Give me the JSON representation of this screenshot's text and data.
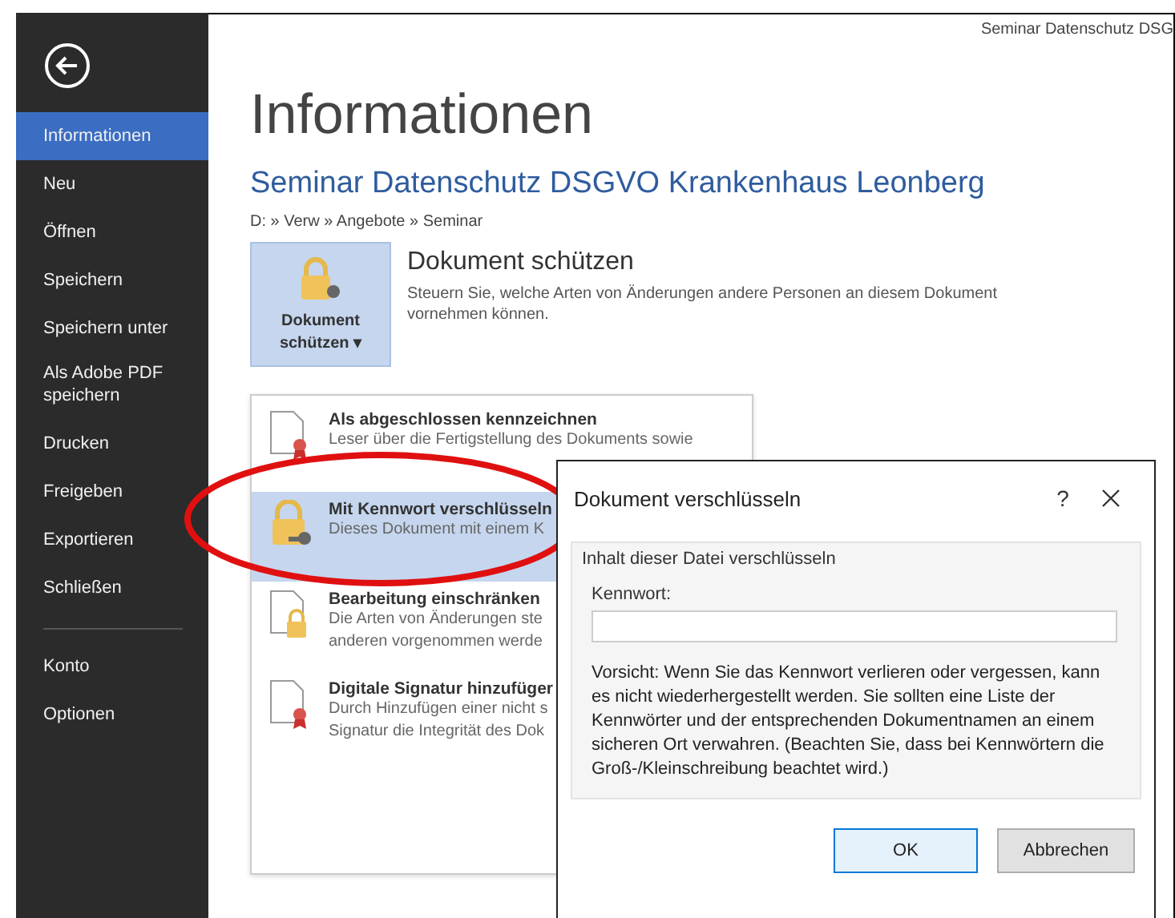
{
  "window": {
    "title": "Seminar Datenschutz DSG"
  },
  "sidebar": {
    "items": [
      {
        "label": "Informationen",
        "selected": true
      },
      {
        "label": "Neu",
        "selected": false
      },
      {
        "label": "Öffnen",
        "selected": false
      },
      {
        "label": "Speichern",
        "selected": false
      },
      {
        "label": "Speichern unter",
        "selected": false
      },
      {
        "label": "Als Adobe PDF speichern",
        "selected": false
      },
      {
        "label": "Drucken",
        "selected": false
      },
      {
        "label": "Freigeben",
        "selected": false
      },
      {
        "label": "Exportieren",
        "selected": false
      },
      {
        "label": "Schließen",
        "selected": false
      }
    ],
    "bottom_items": [
      {
        "label": "Konto",
        "selected": false
      },
      {
        "label": "Optionen",
        "selected": false
      }
    ]
  },
  "page": {
    "heading": "Informationen",
    "document_title": "Seminar Datenschutz DSGVO Krankenhaus Leonberg",
    "path": "D: » Verw » Angebote » Seminar"
  },
  "protect": {
    "button_lines": [
      "Dokument",
      "schützen ▾"
    ],
    "title": "Dokument schützen",
    "description": "Steuern Sie, welche Arten von Änderungen andere Personen an diesem Dokument vornehmen können."
  },
  "protect_menu": [
    {
      "kind": "ribbon",
      "title": "Als abgeschlossen kennzeichnen",
      "lines": [
        "Leser über die Fertigstellung des Dokuments sowie"
      ],
      "selected": false
    },
    {
      "kind": "key",
      "title": "Mit Kennwort verschlüsseln",
      "lines": [
        "Dieses Dokument mit einem K"
      ],
      "selected": true
    },
    {
      "kind": "lock",
      "title": "Bearbeitung einschränken",
      "lines": [
        "Die Arten von Änderungen ste",
        "anderen vorgenommen werde"
      ],
      "selected": false
    },
    {
      "kind": "ribbon",
      "title": "Digitale Signatur hinzufüger",
      "lines": [
        "Durch Hinzufügen einer nicht s",
        "Signatur die Integrität des Dok"
      ],
      "selected": false
    }
  ],
  "dialog": {
    "title": "Dokument verschlüsseln",
    "help": "?",
    "group_title": "Inhalt dieser Datei verschlüsseln",
    "field_label": "Kennwort:",
    "warning": "Vorsicht: Wenn Sie das Kennwort verlieren oder vergessen, kann es nicht wiederhergestellt werden. Sie sollten eine Liste der Kennwörter und der entsprechenden Dokumentnamen an einem sicheren Ort verwahren. (Beachten Sie, dass bei Kennwörtern die Groß-/Kleinschreibung beachtet wird.)",
    "buttons": [
      {
        "label": "OK",
        "default": true
      },
      {
        "label": "Abbrechen",
        "default": false
      }
    ]
  }
}
